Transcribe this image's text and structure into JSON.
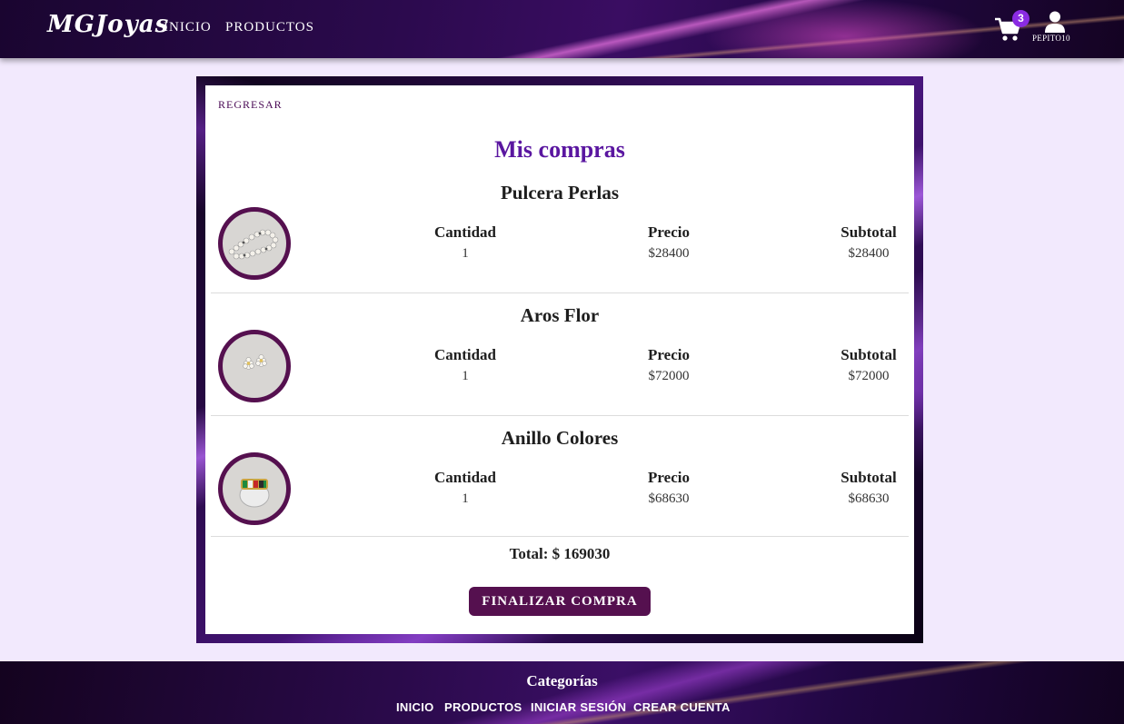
{
  "header": {
    "logo": "MGJoyas",
    "nav": [
      {
        "label": "INICIO"
      },
      {
        "label": "PRODUCTOS"
      }
    ],
    "cart_count": "3",
    "username": "PEPITO10"
  },
  "main": {
    "back_label": "REGRESAR",
    "title": "Mis compras",
    "column_labels": {
      "quantity": "Cantidad",
      "price": "Precio",
      "subtotal": "Subtotal"
    },
    "items": [
      {
        "name": "Pulcera Perlas",
        "quantity": "1",
        "price": "$28400",
        "subtotal": "$28400"
      },
      {
        "name": "Aros Flor",
        "quantity": "1",
        "price": "$72000",
        "subtotal": "$72000"
      },
      {
        "name": "Anillo Colores",
        "quantity": "1",
        "price": "$68630",
        "subtotal": "$68630"
      }
    ],
    "total": "Total: $ 169030",
    "finalize_label": "FINALIZAR COMPRA"
  },
  "footer": {
    "title": "Categorías",
    "links": [
      {
        "label": "INICIO"
      },
      {
        "label": "PRODUCTOS"
      },
      {
        "label": "INICIAR SESIÓN"
      },
      {
        "label": "CREAR CUENTA"
      }
    ]
  },
  "colors": {
    "accent_purple": "#5a16a0",
    "button_plum": "#55104f",
    "badge_purple": "#8a2be2",
    "page_bg": "#f2e9fd"
  }
}
